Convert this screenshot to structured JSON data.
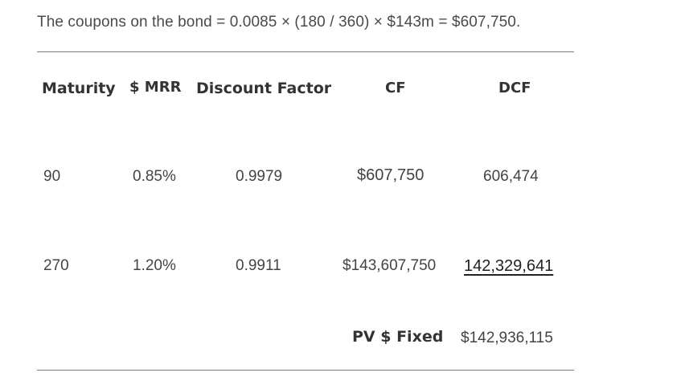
{
  "intro_text": "The coupons on the bond = 0.0085 × (180 / 360) × $143m = $607,750.",
  "table": {
    "headers": {
      "maturity": "Maturity",
      "mrr": "$ MRR",
      "discount_factor": "Discount Factor",
      "cf": "CF",
      "dcf": "DCF"
    },
    "rows": [
      {
        "maturity": "90",
        "mrr": "0.85%",
        "discount_factor": "0.9979",
        "cf": "$607,750",
        "dcf": "606,474"
      },
      {
        "maturity": "270",
        "mrr": "1.20%",
        "discount_factor": "0.9911",
        "cf": "$143,607,750",
        "dcf": "142,329,641"
      }
    ],
    "total": {
      "label": "PV $ Fixed",
      "value": "$142,936,115"
    }
  }
}
